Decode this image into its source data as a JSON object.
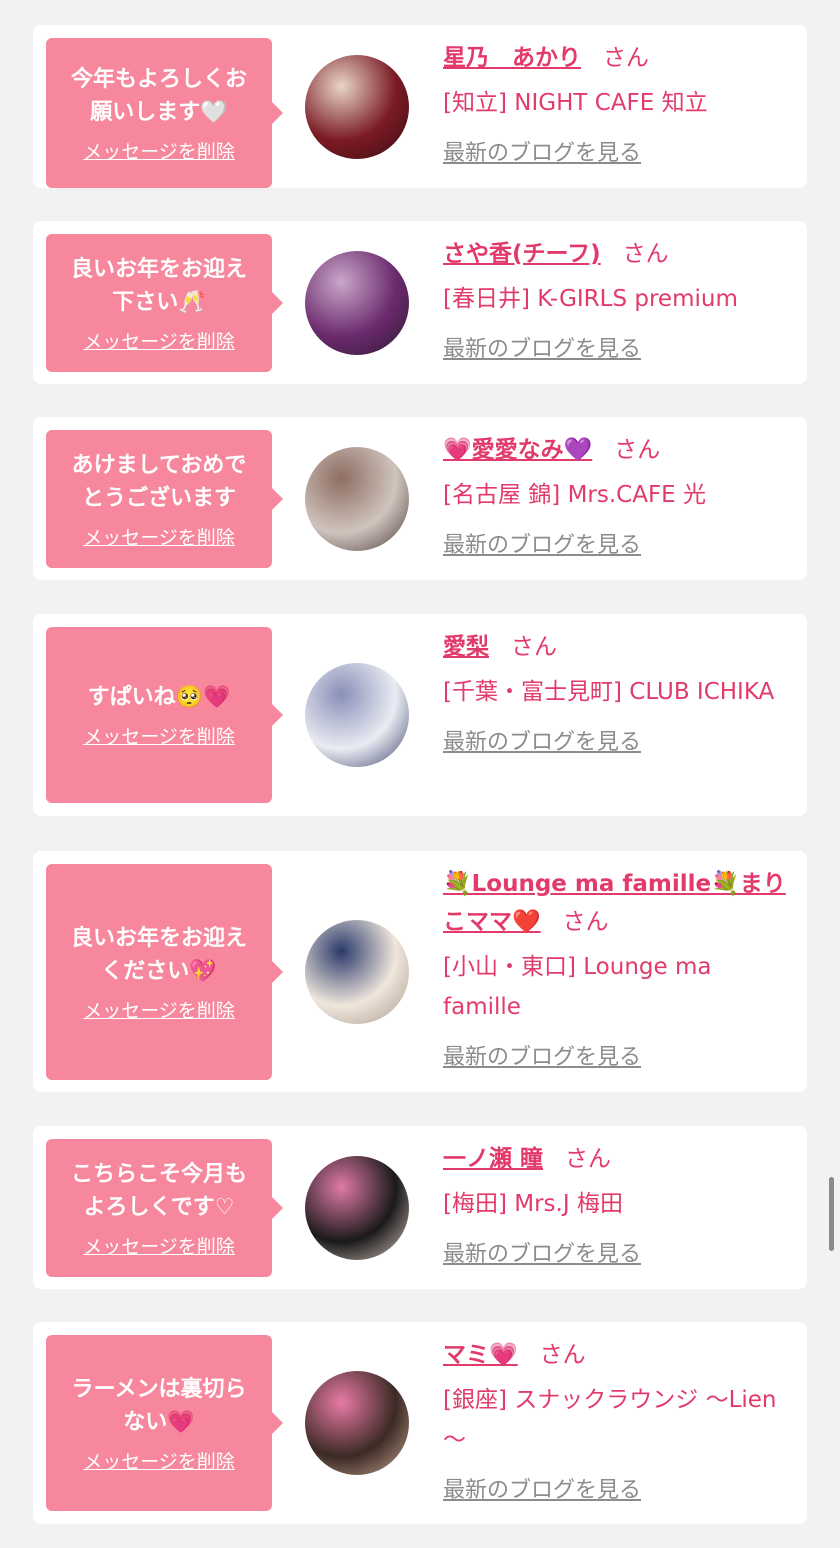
{
  "messages": [
    {
      "message": "今年もよろしくお願いします🤍",
      "delete_label": "メッセージを削除",
      "name": "星乃　あかり",
      "honorific": "さん",
      "shop": "[知立] NIGHT CAFE 知立",
      "blog_label": "最新のブログを見る",
      "avatar_colors": [
        "#7a1a24",
        "#e8d5c8",
        "#3a0e12"
      ]
    },
    {
      "message": "良いお年をお迎え下さい🥂",
      "delete_label": "メッセージを削除",
      "name": "さや香(チーフ)",
      "honorific": "さん",
      "shop": "[春日井] K-GIRLS premium",
      "blog_label": "最新のブログを見る",
      "avatar_colors": [
        "#6b2a6e",
        "#c9a7c8",
        "#2d1a2e"
      ]
    },
    {
      "message": "あけましておめでとうございます",
      "delete_label": "メッセージを削除",
      "name": "💗愛愛なみ💜",
      "honorific": "さん",
      "shop": "[名古屋 錦] Mrs.CAFE 光",
      "blog_label": "最新のブログを見る",
      "avatar_colors": [
        "#cfc4bd",
        "#8e6d62",
        "#4a3a36"
      ]
    },
    {
      "message": "すぱいね🥺💗",
      "delete_label": "メッセージを削除",
      "name": "愛梨",
      "honorific": "さん",
      "shop": "[千葉・富士見町] CLUB ICHIKA",
      "blog_label": "最新のブログを見る",
      "avatar_colors": [
        "#e9ecf2",
        "#8a8fb8",
        "#3b3f6a"
      ]
    },
    {
      "message": "良いお年をお迎えください💖",
      "delete_label": "メッセージを削除",
      "name": "💐Lounge ma famille💐まりこママ❤️",
      "honorific": "さん",
      "shop": "[小山・東口] Lounge ma famille",
      "blog_label": "最新のブログを見る",
      "avatar_colors": [
        "#efe6dc",
        "#2b3a6b",
        "#a9968a"
      ]
    },
    {
      "message": "こちらこそ今月もよろしくです♡",
      "delete_label": "メッセージを削除",
      "name": "一ノ瀬 瞳",
      "honorific": "さん",
      "shop": "[梅田] Mrs.J 梅田",
      "blog_label": "最新のブログを見る",
      "avatar_colors": [
        "#1a1a1a",
        "#e07aa8",
        "#d9c6bf"
      ]
    },
    {
      "message": "ラーメンは裏切らない💗",
      "delete_label": "メッセージを削除",
      "name": "マミ💗",
      "honorific": "さん",
      "shop": "[銀座] スナックラウンジ ～Lien～",
      "blog_label": "最新のブログを見る",
      "avatar_colors": [
        "#3b2a24",
        "#e97aa6",
        "#c9a691"
      ]
    }
  ]
}
